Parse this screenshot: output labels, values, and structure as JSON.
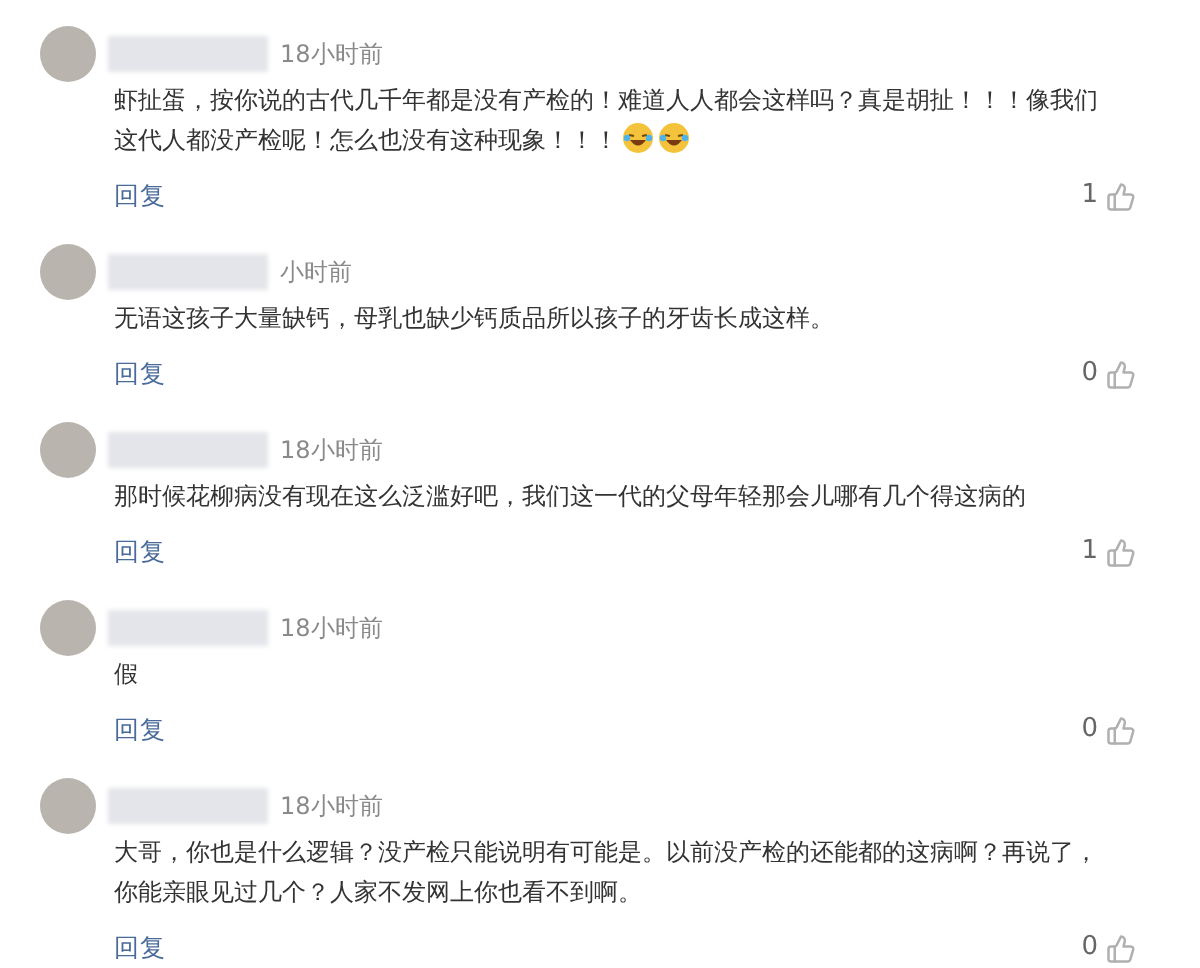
{
  "comments": [
    {
      "time": "18小时前",
      "lines": [
        "虾扯蛋，按你说的古代几千年都是没有产检的！难道人人都会这样吗？真是胡扯！！！像我们",
        "这代人都没产检呢！怎么也没有这种现象！！！"
      ],
      "emojis": [
        {
          "kind": "laughing"
        },
        {
          "kind": "laughing"
        }
      ],
      "reply": "回复",
      "likes": "1"
    },
    {
      "time": "小时前",
      "lines": [
        "无语这孩子大量缺钙，母乳也缺少钙质品所以孩子的牙齿长成这样。"
      ],
      "reply": "回复",
      "likes": "0"
    },
    {
      "time": "18小时前",
      "lines": [
        "那时候花柳病没有现在这么泛滥好吧，我们这一代的父母年轻那会儿哪有几个得这病的"
      ],
      "reply": "回复",
      "likes": "1"
    },
    {
      "time": "18小时前",
      "lines": [
        "假"
      ],
      "reply": "回复",
      "likes": "0"
    },
    {
      "time": "18小时前",
      "lines": [
        "大哥，你也是什么逻辑？没产检只能说明有可能是。以前没产检的还能都的这病啊？再说了，",
        "你能亲眼见过几个？人家不发网上你也看不到啊。"
      ],
      "reply": "回复",
      "likes": "0"
    }
  ]
}
